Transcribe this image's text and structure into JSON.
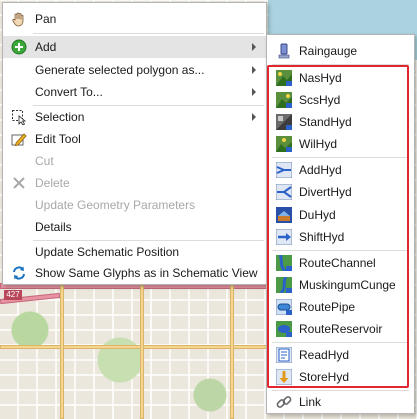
{
  "map": {
    "route_shield": "427"
  },
  "context_menu": {
    "items": [
      {
        "label": "Pan",
        "icon": "hand-icon"
      },
      {
        "label": "Add",
        "icon": "add-icon",
        "has_submenu": true
      },
      {
        "label": "Generate selected polygon as...",
        "has_submenu": true
      },
      {
        "label": "Convert To...",
        "has_submenu": true
      },
      {
        "label": "Selection",
        "icon": "selection-icon",
        "has_submenu": true
      },
      {
        "label": "Edit Tool",
        "icon": "edit-tool-icon"
      },
      {
        "label": "Cut",
        "disabled": true
      },
      {
        "label": "Delete",
        "icon": "delete-icon",
        "disabled": true
      },
      {
        "label": "Update Geometry Parameters",
        "disabled": true
      },
      {
        "label": "Details"
      },
      {
        "label": "Update Schematic Position"
      },
      {
        "label": "Show Same Glyphs as in Schematic View",
        "icon": "sync-icon"
      }
    ]
  },
  "add_submenu": {
    "items": [
      {
        "label": "Raingauge",
        "icon": "raingauge-icon"
      },
      {
        "label": "NasHyd",
        "icon": "nashyd-icon"
      },
      {
        "label": "ScsHyd",
        "icon": "scshyd-icon"
      },
      {
        "label": "StandHyd",
        "icon": "standhyd-icon"
      },
      {
        "label": "WilHyd",
        "icon": "wilhyd-icon"
      },
      {
        "label": "AddHyd",
        "icon": "addhyd-icon"
      },
      {
        "label": "DivertHyd",
        "icon": "diverthyd-icon"
      },
      {
        "label": "DuHyd",
        "icon": "duhyd-icon"
      },
      {
        "label": "ShiftHyd",
        "icon": "shifthyd-icon"
      },
      {
        "label": "RouteChannel",
        "icon": "routechannel-icon"
      },
      {
        "label": "MuskingumCunge",
        "icon": "muskingumcunge-icon"
      },
      {
        "label": "RoutePipe",
        "icon": "routepipe-icon"
      },
      {
        "label": "RouteReservoir",
        "icon": "routereservoir-icon"
      },
      {
        "label": "ReadHyd",
        "icon": "readhyd-icon"
      },
      {
        "label": "StoreHyd",
        "icon": "storehyd-icon"
      },
      {
        "label": "Link",
        "icon": "link-icon"
      }
    ]
  },
  "colors": {
    "highlight_box": "#e2262e",
    "menu_hover": "#e4e4e4",
    "disabled_text": "#a8a8a8"
  }
}
